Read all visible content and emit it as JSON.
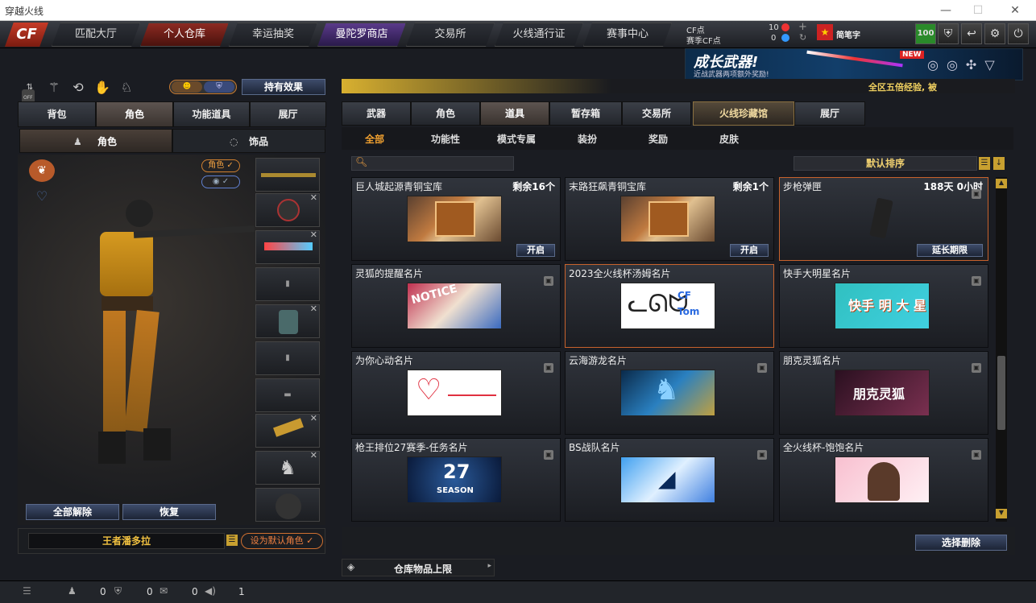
{
  "window": {
    "title": "穿越火线"
  },
  "nav": {
    "tabs": [
      "匹配大厅",
      "个人仓库",
      "幸运抽奖",
      "曼陀罗商店",
      "交易所",
      "火线通行证",
      "赛事中心"
    ],
    "active": 1,
    "cf_label": "CF点",
    "cf_value": "10",
    "match_cf_label": "赛季CF点",
    "match_cf_value": "0",
    "username": "简笔字",
    "level": "100"
  },
  "banner": {
    "title": "成长武器!",
    "subtitle": "近战武器两项额外奖励!",
    "badge": "NEW"
  },
  "ticker": {
    "text": "全区五倍经验, 被"
  },
  "left": {
    "off_label": "OFF",
    "effect_button": "持有效果",
    "tabs": [
      "背包",
      "角色",
      "功能道具",
      "展厅"
    ],
    "active_tab": 1,
    "subtabs": [
      "角色",
      "饰品"
    ],
    "role_toggle": "角色",
    "clear_all": "全部解除",
    "restore": "恢复",
    "role_name": "王者潘多拉",
    "set_default": "设为默认角色"
  },
  "right": {
    "tabs": [
      "武器",
      "角色",
      "道具",
      "暂存箱",
      "交易所",
      "火线珍藏馆",
      "展厅"
    ],
    "active_tab": 2,
    "subtabs": [
      "全部",
      "功能性",
      "模式专属",
      "装扮",
      "奖励",
      "皮肤"
    ],
    "sort_label": "默认排序",
    "items": [
      {
        "name": "巨人城起源青铜宝库",
        "remain": "剩余16个",
        "action": "开启",
        "img": "chest"
      },
      {
        "name": "末路狂飙青铜宝库",
        "remain": "剩余1个",
        "action": "开启",
        "img": "chest"
      },
      {
        "name": "步枪弹匣",
        "remain": "188天 0小时",
        "action": "延长期限",
        "img": "mag"
      },
      {
        "name": "灵狐的提醒名片",
        "remain": "",
        "action": "",
        "img": "notice"
      },
      {
        "name": "2023全火线杯汤姆名片",
        "remain": "",
        "action": "",
        "img": "tom"
      },
      {
        "name": "快手大明星名片",
        "remain": "",
        "action": "",
        "img": "kuaishou"
      },
      {
        "name": "为你心动名片",
        "remain": "",
        "action": "",
        "img": "heart"
      },
      {
        "name": "云海游龙名片",
        "remain": "",
        "action": "",
        "img": "dragon"
      },
      {
        "name": "朋克灵狐名片",
        "remain": "",
        "action": "",
        "img": "punk"
      },
      {
        "name": "枪王排位27赛季-任务名片",
        "remain": "",
        "action": "",
        "img": "season"
      },
      {
        "name": "BS战队名片",
        "remain": "",
        "action": "",
        "img": "bs"
      },
      {
        "name": "全火线杯-饱饱名片",
        "remain": "",
        "action": "",
        "img": "baobao"
      }
    ],
    "tom_text": [
      "CF",
      "Tom"
    ],
    "kuaishou_text": "快手 明 大 星",
    "punk_text": "朋克灵狐",
    "season_num": "27",
    "season_word": "SEASON",
    "select_delete": "选择删除",
    "storage_limit": "仓库物品上限"
  },
  "status": {
    "values": [
      "0",
      "0",
      "0",
      "1"
    ]
  }
}
